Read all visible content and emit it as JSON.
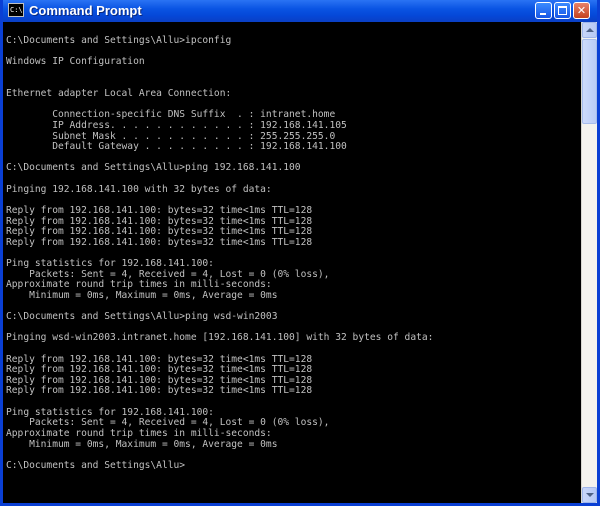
{
  "window": {
    "title": "Command Prompt",
    "icon_name": "cmd-icon",
    "icon_text": "C:\\",
    "controls": [
      "minimize",
      "maximize",
      "close"
    ]
  },
  "colors": {
    "titlebar": "#0a54e3",
    "console_bg": "#000000",
    "console_fg": "#c0c0c0"
  },
  "console": {
    "lines": [
      "C:\\Documents and Settings\\Allu>ipconfig",
      "",
      "Windows IP Configuration",
      "",
      "",
      "Ethernet adapter Local Area Connection:",
      "",
      "        Connection-specific DNS Suffix  . : intranet.home",
      "        IP Address. . . . . . . . . . . . : 192.168.141.105",
      "        Subnet Mask . . . . . . . . . . . : 255.255.255.0",
      "        Default Gateway . . . . . . . . . : 192.168.141.100",
      "",
      "C:\\Documents and Settings\\Allu>ping 192.168.141.100",
      "",
      "Pinging 192.168.141.100 with 32 bytes of data:",
      "",
      "Reply from 192.168.141.100: bytes=32 time<1ms TTL=128",
      "Reply from 192.168.141.100: bytes=32 time<1ms TTL=128",
      "Reply from 192.168.141.100: bytes=32 time<1ms TTL=128",
      "Reply from 192.168.141.100: bytes=32 time<1ms TTL=128",
      "",
      "Ping statistics for 192.168.141.100:",
      "    Packets: Sent = 4, Received = 4, Lost = 0 (0% loss),",
      "Approximate round trip times in milli-seconds:",
      "    Minimum = 0ms, Maximum = 0ms, Average = 0ms",
      "",
      "C:\\Documents and Settings\\Allu>ping wsd-win2003",
      "",
      "Pinging wsd-win2003.intranet.home [192.168.141.100] with 32 bytes of data:",
      "",
      "Reply from 192.168.141.100: bytes=32 time<1ms TTL=128",
      "Reply from 192.168.141.100: bytes=32 time<1ms TTL=128",
      "Reply from 192.168.141.100: bytes=32 time<1ms TTL=128",
      "Reply from 192.168.141.100: bytes=32 time<1ms TTL=128",
      "",
      "Ping statistics for 192.168.141.100:",
      "    Packets: Sent = 4, Received = 4, Lost = 0 (0% loss),",
      "Approximate round trip times in milli-seconds:",
      "    Minimum = 0ms, Maximum = 0ms, Average = 0ms",
      "",
      "C:\\Documents and Settings\\Allu>"
    ]
  }
}
